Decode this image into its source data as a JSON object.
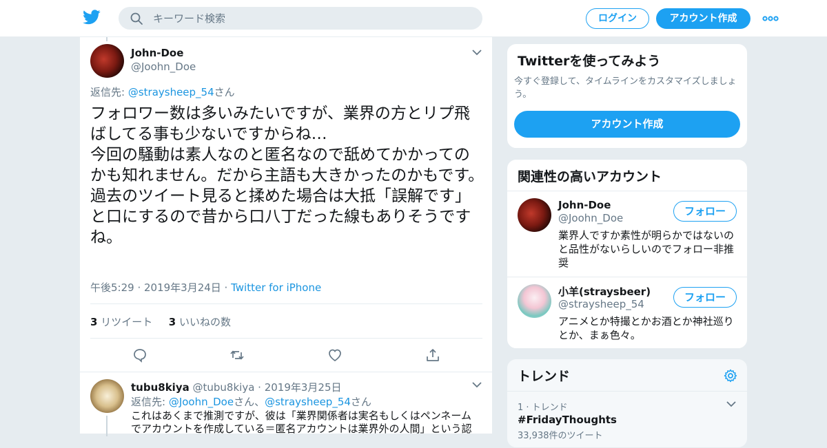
{
  "header": {
    "search_placeholder": "キーワード検索",
    "login_label": "ログイン",
    "signup_label": "アカウント作成"
  },
  "tweet": {
    "name": "John-Doe",
    "handle": "@Joohn_Doe",
    "reply_prefix": "返信先: ",
    "reply_to": "@straysheep_54",
    "reply_suffix": "さん",
    "text": "フォロワー数は多いみたいですが、業界の方とリプ飛ばしてる事も少ないですからね…\n今回の騒動は素人なのと匿名なので舐めてかかってのかも知れません。だから主語も大きかったのかもです。\n過去のツイート見ると揉めた場合は大抵「誤解です」と口にするので昔から口八丁だった線もありそうですね。",
    "time": "午後5:29 · 2019年3月24日 · ",
    "source": "Twitter for iPhone",
    "retweets_count": "3",
    "retweets_label": " リツイート",
    "likes_count": "3",
    "likes_label": " いいねの数"
  },
  "reply": {
    "name": "tubu8kiya",
    "handle": "@tubu8kiya",
    "date": " · 2019年3月25日",
    "reply_prefix": "返信先: ",
    "to1": "@Joohn_Doe",
    "mid": "さん、",
    "to2": "@straysheep_54",
    "suffix": "さん",
    "text": "これはあくまで推測ですが、彼は「業界関係者は実名もしくはペンネーム\nでアカウントを作成している＝匿名アカウントは業界外の人間」という認"
  },
  "sidebar": {
    "signup_card": {
      "title": "Twitterを使ってみよう",
      "desc": "今すぐ登録して、タイムラインをカスタマイズしましょう。",
      "button": "アカウント作成"
    },
    "related": {
      "title": "関連性の高いアカウント",
      "follow_label": "フォロー",
      "accounts": [
        {
          "name": "John-Doe",
          "handle": "@Joohn_Doe",
          "bio": "業界人ですか素性が明らかではないのと品性がないらしいのでフォロー非推奨"
        },
        {
          "name": "小羊(straysbeer)",
          "handle": "@straysheep_54",
          "bio": "アニメとか特撮とかお酒とか神社巡りとか、まぁ色々。"
        }
      ]
    },
    "trends": {
      "title": "トレンド",
      "items": [
        {
          "rank": "1 · トレンド",
          "tag": "#FridayThoughts",
          "count": "33,938件のツイート"
        }
      ]
    }
  },
  "colors": {
    "accent": "#1da1f2",
    "link": "#1b95e0",
    "muted": "#657786"
  }
}
